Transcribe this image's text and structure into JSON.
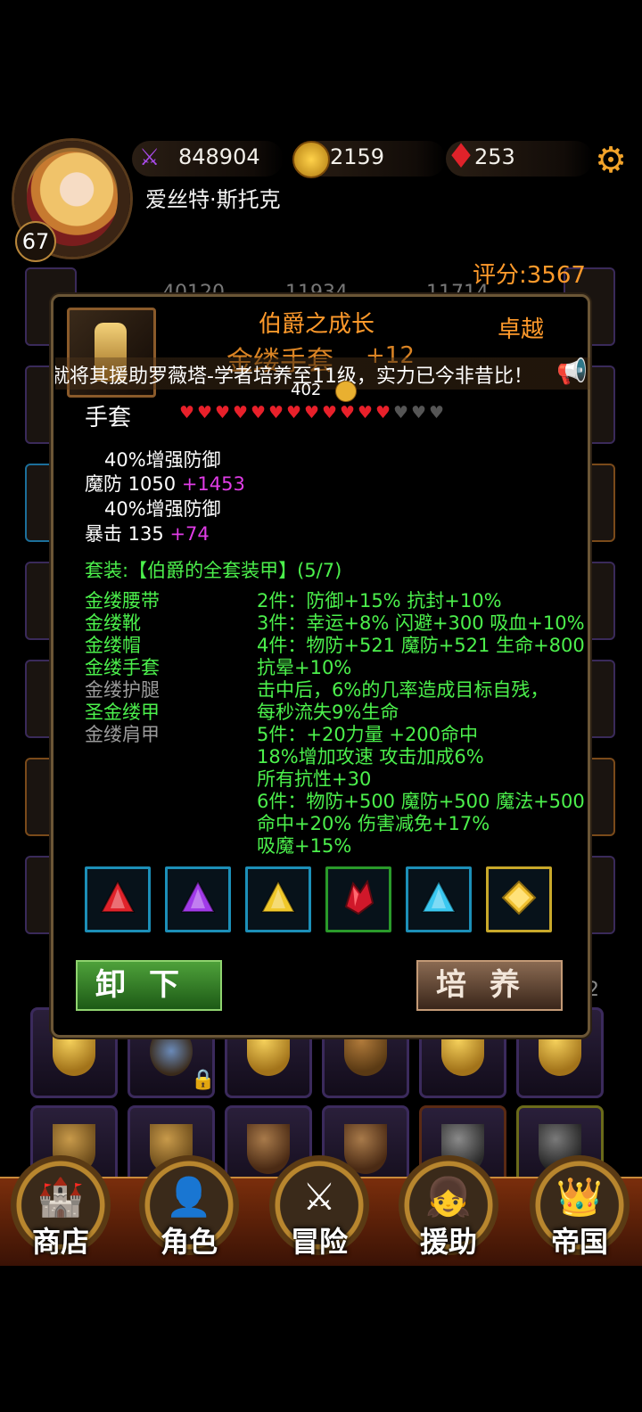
{
  "header": {
    "level": "67",
    "hero_name": "爱丝特·斯托克",
    "power": "848904",
    "gold": "2159",
    "gems": "253"
  },
  "score": "评分:3567",
  "background_stats": [
    "40120",
    "11934",
    "11714"
  ],
  "background_page_number": "2",
  "item": {
    "set_title": "伯爵之成长",
    "quality": "卓越",
    "name": "金缕手套",
    "enhance": "+12",
    "price": "402",
    "slot_type": "手套",
    "stars_filled": 12,
    "stars_total": 15
  },
  "ticker": "就将其援助罗薇塔-学者培养至11级，实力已今非昔比！",
  "stats": {
    "line1": "40%增强防御",
    "line2_label": "魔防 1050",
    "line2_bonus": "+1453",
    "line3": "40%增强防御",
    "line4_label": "暴击 135",
    "line4_bonus": "+74"
  },
  "set": {
    "header": "套装:【伯爵的全套装甲】(5/7)",
    "pieces": [
      {
        "name": "金缕腰带",
        "owned": true
      },
      {
        "name": "金缕靴",
        "owned": true
      },
      {
        "name": "金缕帽",
        "owned": true
      },
      {
        "name": "金缕手套",
        "owned": true
      },
      {
        "name": "金缕护腿",
        "owned": false
      },
      {
        "name": "圣金缕甲",
        "owned": true
      },
      {
        "name": "金缕肩甲",
        "owned": false
      }
    ],
    "effects": [
      "2件：防御+15% 抗封+10%",
      "3件：幸运+8% 闪避+300 吸血+10%",
      "4件：物防+521 魔防+521 生命+800",
      "抗晕+10%",
      "击中后，6%的几率造成目标自残，",
      "每秒流失9%生命",
      "5件：+20力量 +200命中",
      "18%增加攻速 攻击加成6%",
      "所有抗性+30",
      "6件：物防+500 魔防+500 魔法+500",
      "命中+20% 伤害减免+17%",
      "吸魔+15%"
    ]
  },
  "gems": [
    {
      "name": "red-gem-icon",
      "color": "#e0222a",
      "frame": "#1c8fb8"
    },
    {
      "name": "purple-gem-icon",
      "color": "#a03ae8",
      "frame": "#1c8fb8"
    },
    {
      "name": "yellow-gem-icon",
      "color": "#f0c82a",
      "frame": "#1c8fb8"
    },
    {
      "name": "red-crystal-icon",
      "color": "#d0182a",
      "frame": "#2a9a2a"
    },
    {
      "name": "blue-gem-icon",
      "color": "#3ac8f0",
      "frame": "#1c8fb8"
    },
    {
      "name": "gold-gem-icon",
      "color": "#f0c030",
      "frame": "#c8a82a"
    }
  ],
  "buttons": {
    "unequip": "卸下",
    "train": "培养"
  },
  "nav": [
    {
      "label": "商店",
      "icon": "castle-icon"
    },
    {
      "label": "角色",
      "icon": "hooded-character-icon"
    },
    {
      "label": "冒险",
      "icon": "dungeon-gate-icon"
    },
    {
      "label": "援助",
      "icon": "helper-girl-icon"
    },
    {
      "label": "帝国",
      "icon": "crown-icon"
    }
  ],
  "colors": {
    "accent_orange": "#ff9a2b",
    "set_green": "#4cf04c",
    "bonus_magenta": "#e03ce6"
  }
}
